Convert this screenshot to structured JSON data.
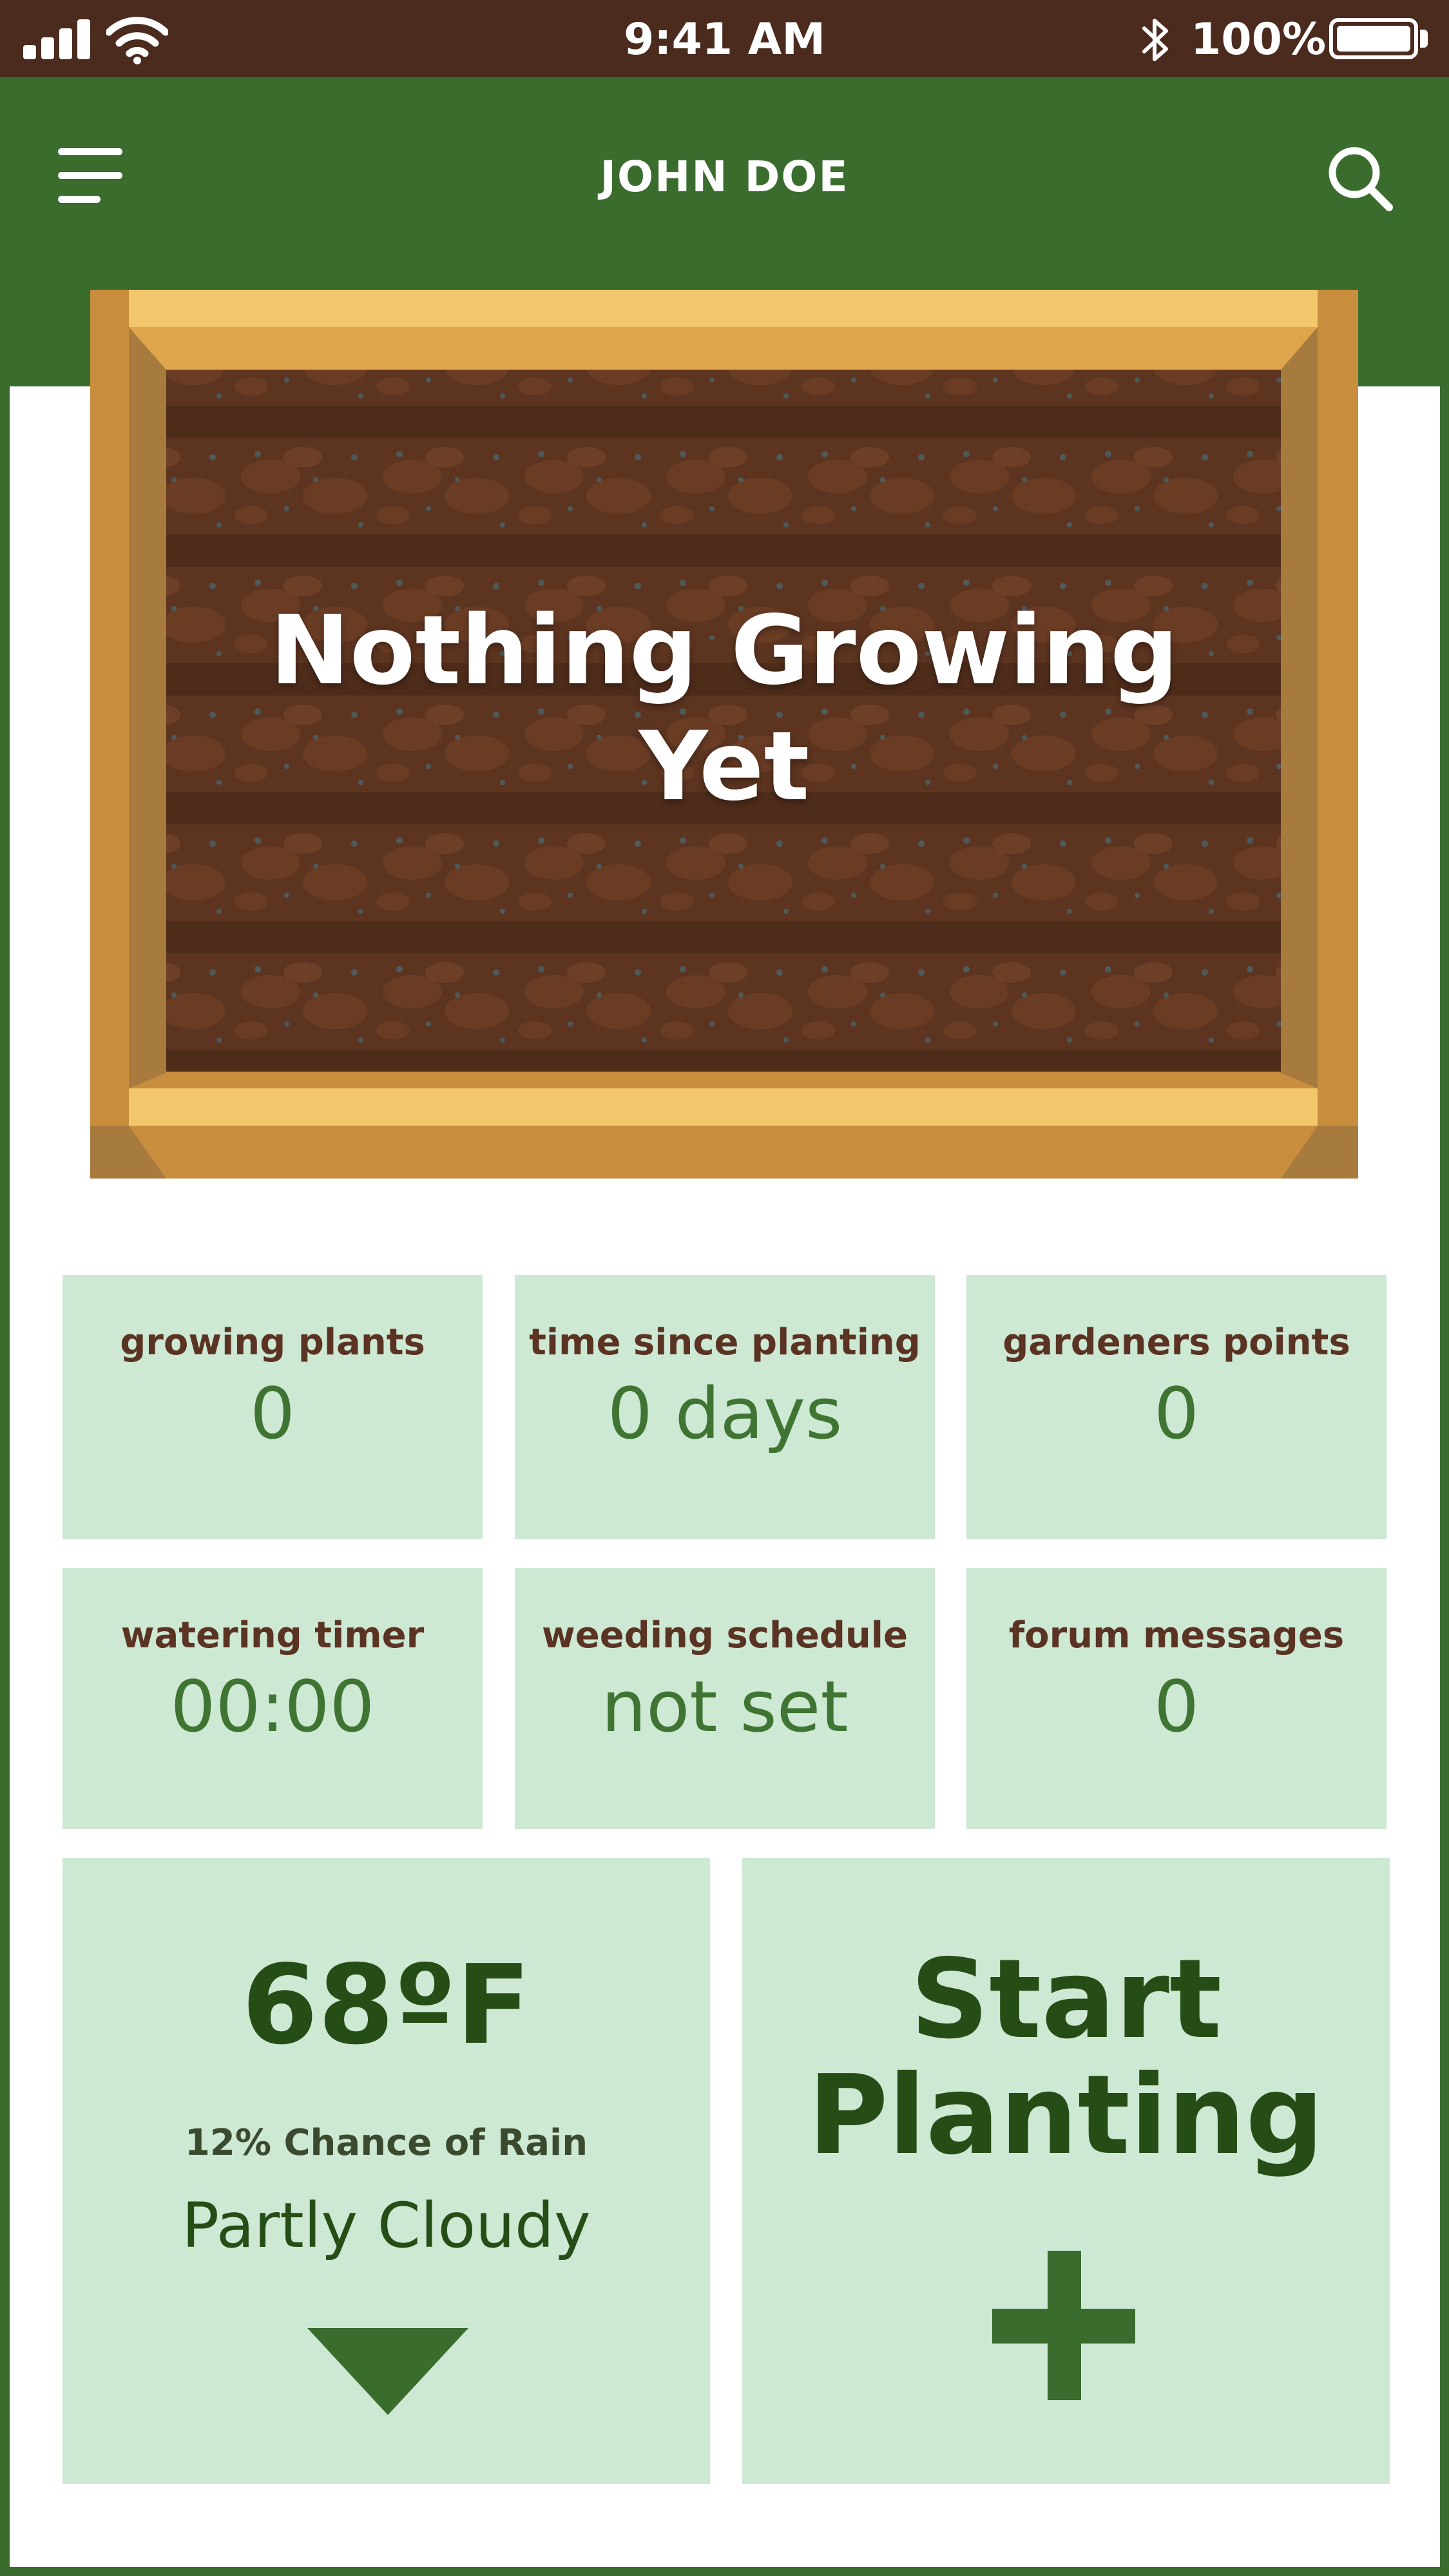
{
  "status_bar": {
    "time": "9:41 AM",
    "battery_percent": "100%",
    "signal_bars": 4,
    "icons": [
      "signal-icon",
      "wifi-icon",
      "bluetooth-icon",
      "battery-icon"
    ]
  },
  "header": {
    "title": "JOHN DOE",
    "menu_icon": "hamburger-menu-icon",
    "search_icon": "search-icon"
  },
  "garden_bed": {
    "message": "Nothing Growing Yet"
  },
  "stats": [
    {
      "label": "growing plants",
      "value": "0"
    },
    {
      "label": "time since planting",
      "value": "0 days"
    },
    {
      "label": "gardeners points",
      "value": "0"
    },
    {
      "label": "watering timer",
      "value": "00:00"
    },
    {
      "label": "weeding schedule",
      "value": "not set"
    },
    {
      "label": "forum messages",
      "value": "0"
    }
  ],
  "weather": {
    "temperature": "68ºF",
    "rain_chance": "12% Chance of Rain",
    "condition": "Partly Cloudy",
    "toggle_icon": "triangle-down-icon"
  },
  "start_planting": {
    "label_line1": "Start",
    "label_line2": "Planting",
    "icon": "plus-icon"
  },
  "colors": {
    "header_green": "#3a6c2e",
    "status_brown": "#4a2b1e",
    "tile_mint": "#cde8d3",
    "label_brown": "#5a3323",
    "value_green": "#3f7432",
    "dark_green": "#264d16",
    "wood": "#c98e3d",
    "soil": "#5c3420"
  }
}
